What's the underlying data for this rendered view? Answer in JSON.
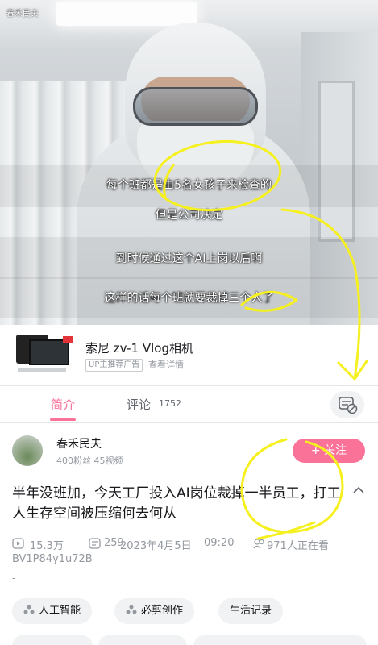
{
  "video": {
    "uploader_tag": "春禾民夫",
    "subtitles": [
      "每个班都是由5名女孩子来检查的",
      "但是公司决定",
      "到时候通过这个AI上岗以后啊",
      "这样的话每个班就要裁掉三个人了"
    ]
  },
  "ad": {
    "title": "索尼 zv-1 Vlog相机",
    "badge": "UP主推荐广告",
    "link": "查看详情"
  },
  "tabs": {
    "intro": "简介",
    "comments": "评论",
    "comments_count": "1752"
  },
  "uploader": {
    "name": "春禾民夫",
    "stats": "400粉丝  45视频",
    "follow": "+ 关注"
  },
  "video_info": {
    "title": "半年没班加，今天工厂投入AI岗位裁掉一半员工，打工人生存空间被压缩何去何从",
    "views": "15.3万",
    "danmaku": "259",
    "date": "2023年4月5日",
    "time": "09:20",
    "watching": "971人正在看",
    "bvid": "BV1P84y1u72B",
    "dash": "-"
  },
  "tags": [
    {
      "label": "人工智能"
    },
    {
      "label": "必剪创作"
    },
    {
      "label": "生活记录"
    }
  ],
  "colors": {
    "accent": "#fb7299",
    "annotation": "#f5f01e"
  }
}
